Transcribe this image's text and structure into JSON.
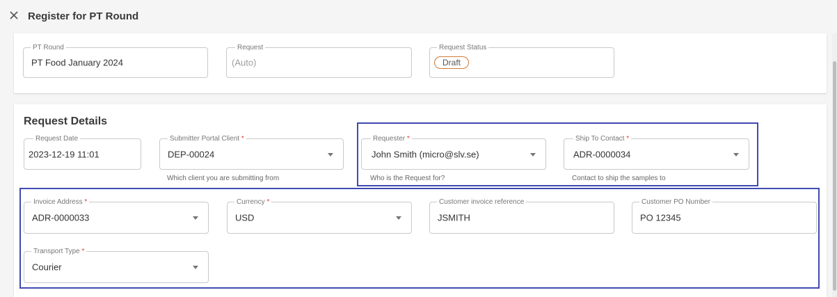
{
  "header": {
    "title": "Register for PT Round",
    "close_icon": "close-icon"
  },
  "top_card": {
    "pt_round": {
      "label": "PT Round",
      "value": "PT Food January 2024"
    },
    "request": {
      "label": "Request",
      "placeholder": "(Auto)"
    },
    "request_status": {
      "label": "Request Status",
      "value": "Draft"
    }
  },
  "details": {
    "title": "Request Details",
    "request_date": {
      "label": "Request Date",
      "value": "2023-12-19 11:01"
    },
    "submitter": {
      "label": "Submitter Portal Client",
      "value": "DEP-00024",
      "helper": "Which client you are submitting from"
    },
    "requester": {
      "label": "Requester",
      "value": "John Smith (micro@slv.se)",
      "helper": "Who is the Request for?"
    },
    "ship_to": {
      "label": "Ship To Contact",
      "value": "ADR-0000034",
      "helper": "Contact to ship the samples to"
    },
    "invoice_address": {
      "label": "Invoice Address",
      "value": "ADR-0000033"
    },
    "currency": {
      "label": "Currency",
      "value": "USD"
    },
    "customer_invoice_ref": {
      "label": "Customer invoice reference",
      "value": "JSMITH"
    },
    "customer_po": {
      "label": "Customer PO Number",
      "value": "PO 12345"
    },
    "transport_type": {
      "label": "Transport Type",
      "value": "Courier"
    },
    "required_mark": "*"
  },
  "colors": {
    "highlight": "#3f4ab0",
    "status_border": "#d07a38",
    "required": "#e53935"
  }
}
